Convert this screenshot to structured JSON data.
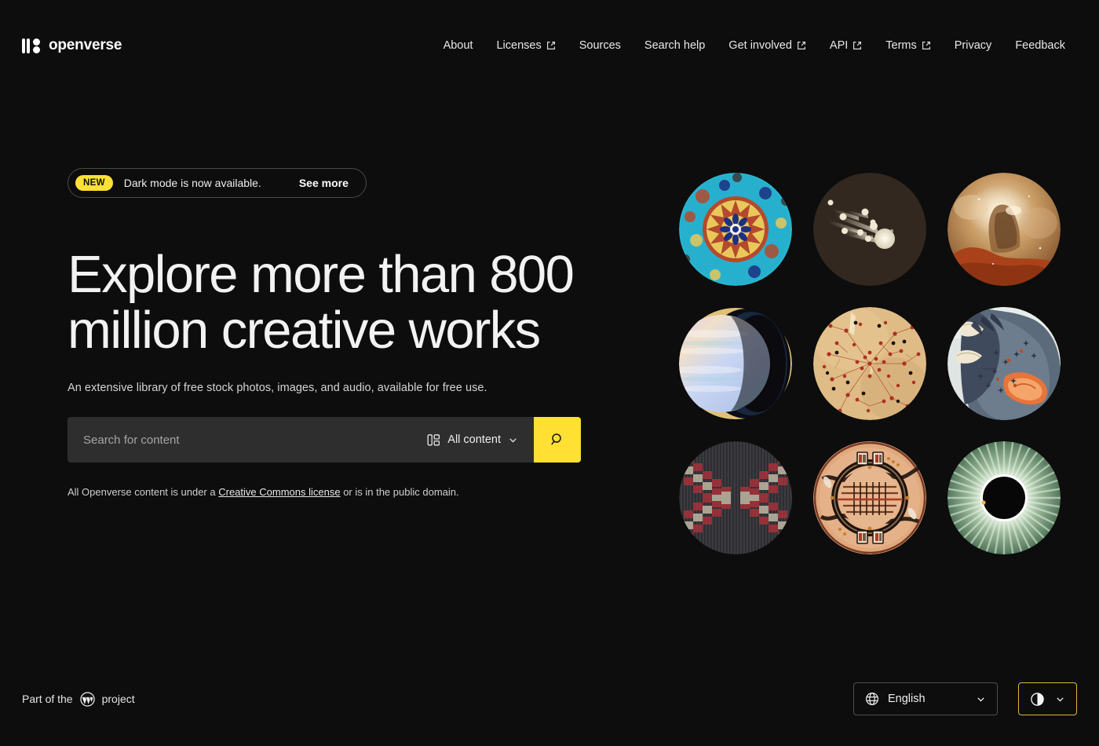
{
  "brand": {
    "name": "openverse",
    "mark_icon": "openverse-logo-icon"
  },
  "nav": {
    "items": [
      {
        "label": "About",
        "external": false
      },
      {
        "label": "Licenses",
        "external": true
      },
      {
        "label": "Sources",
        "external": false
      },
      {
        "label": "Search help",
        "external": false
      },
      {
        "label": "Get involved",
        "external": true
      },
      {
        "label": "API",
        "external": true
      },
      {
        "label": "Terms",
        "external": true
      },
      {
        "label": "Privacy",
        "external": false
      },
      {
        "label": "Feedback",
        "external": false
      }
    ]
  },
  "promo": {
    "badge": "NEW",
    "text": "Dark mode is now available.",
    "cta": "See more",
    "badge_color": "#ffe033"
  },
  "hero": {
    "title": "Explore more than 800 million creative works",
    "subtitle": "An extensive library of free stock photos, images, and audio, available for free use."
  },
  "search": {
    "placeholder": "Search for content",
    "value": "",
    "content_type": "All content",
    "content_type_icon": "content-switcher-icon",
    "search_icon": "search-icon",
    "button_color": "#ffe033"
  },
  "license_note": {
    "prefix": "All Openverse content is under a ",
    "link": "Creative Commons license",
    "suffix": " or is in the public domain."
  },
  "gallery": {
    "items": [
      {
        "name": "iznik-ceramic-plate",
        "alt": "Turquoise Iznik ceramic plate with radial floral mandala"
      },
      {
        "name": "comet-engraving",
        "alt": "Sepia vintage engraving of comets with tails"
      },
      {
        "name": "carina-nebula",
        "alt": "Orange and brown nebula pillar in space"
      },
      {
        "name": "saturn-rings",
        "alt": "Pastel Saturn with golden rings"
      },
      {
        "name": "antique-star-chart",
        "alt": "Antique parchment star chart with red constellation dots"
      },
      {
        "name": "taurus-bull-constellation",
        "alt": "Blue-grey bull constellation illustration with orange ear"
      },
      {
        "name": "navajo-textile-x",
        "alt": "Navajo textile with red and cream zigzag X pattern"
      },
      {
        "name": "mesoamerican-disc",
        "alt": "Terracotta circular disc with dark ring and glyph panels"
      },
      {
        "name": "solar-eclipse",
        "alt": "Green solar eclipse corona rays around black disc"
      }
    ]
  },
  "footer": {
    "credit_prefix": "Part of the",
    "credit_icon": "wordpress-logo-icon",
    "credit_suffix": "project",
    "language": {
      "icon": "globe-icon",
      "value": "English"
    },
    "theme": {
      "icon": "contrast-icon",
      "border_color": "#d8b93a"
    }
  }
}
